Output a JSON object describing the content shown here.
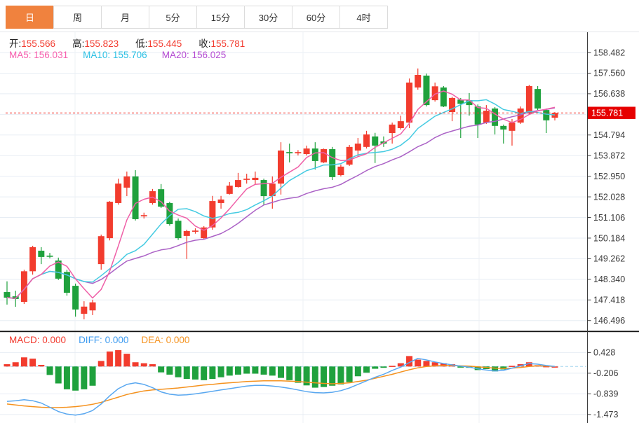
{
  "tabs": {
    "items": [
      {
        "label": "日",
        "active": true
      },
      {
        "label": "周",
        "active": false
      },
      {
        "label": "月",
        "active": false
      },
      {
        "label": "5分",
        "active": false
      },
      {
        "label": "15分",
        "active": false
      },
      {
        "label": "30分",
        "active": false
      },
      {
        "label": "60分",
        "active": false
      },
      {
        "label": "4时",
        "active": false
      }
    ]
  },
  "info": {
    "ohlc": [
      {
        "label": "开:",
        "value": "155.566"
      },
      {
        "label": "高:",
        "value": "155.823"
      },
      {
        "label": "低:",
        "value": "155.445"
      },
      {
        "label": "收:",
        "value": "155.781"
      }
    ],
    "ma": [
      {
        "label": "MA5:",
        "value": "156.031"
      },
      {
        "label": "MA10:",
        "value": "155.706"
      },
      {
        "label": "MA20:",
        "value": "156.025"
      }
    ]
  },
  "macd_header": [
    {
      "label": "MACD:",
      "value": "0.000"
    },
    {
      "label": "DIFF:",
      "value": "0.000"
    },
    {
      "label": "DEA:",
      "value": "0.000"
    }
  ],
  "colors": {
    "tab_active": "#f0823e",
    "up": "#f23c2e",
    "down": "#1fa13d",
    "ma5": "#ef5fa7",
    "ma10": "#45cbe2",
    "ma20": "#ab62c6",
    "diff_line": "#5aa8f0",
    "dea_line": "#f5921e",
    "grid": "#e7edf4",
    "vgrid": "#edf1f6",
    "axis": "#3c3c3c",
    "badge_bg": "#e60000",
    "dotted_line": "#f5352f",
    "zero_dash": "#a5d5ef",
    "tick_text": "#3a3a3a",
    "separator": "#151515"
  },
  "chart_data": {
    "type": "candlestick+macd",
    "title": "",
    "price_axis": {
      "price_top": 158.482,
      "step_val": 0.922,
      "grid_count": 14,
      "visible_ticks": [
        "158.482",
        "157.560",
        "156.638",
        "154.794",
        "153.872",
        "152.950",
        "152.028",
        "151.106",
        "150.184",
        "149.262",
        "148.340",
        "147.418",
        "146.496"
      ],
      "hidden_tick": "155.716"
    },
    "last_price": "155.781",
    "vgrid_x": [
      107,
      432,
      683
    ],
    "candles": [
      [
        147.77,
        148.25,
        147.21,
        147.52
      ],
      [
        147.58,
        147.83,
        147.11,
        147.46
      ],
      [
        147.33,
        148.77,
        147.24,
        148.7
      ],
      [
        148.7,
        149.84,
        148.55,
        149.78
      ],
      [
        149.62,
        149.78,
        149.02,
        149.34
      ],
      [
        149.4,
        149.52,
        149.28,
        149.38
      ],
      [
        149.18,
        149.31,
        148.31,
        148.37
      ],
      [
        148.67,
        148.77,
        147.61,
        147.74
      ],
      [
        148.05,
        148.15,
        146.67,
        146.99
      ],
      [
        146.8,
        147.36,
        146.55,
        147.12
      ],
      [
        146.95,
        147.43,
        146.74,
        147.31
      ],
      [
        149.02,
        150.34,
        148.77,
        150.27
      ],
      [
        150.18,
        151.84,
        150.08,
        151.81
      ],
      [
        151.75,
        152.84,
        151.68,
        152.62
      ],
      [
        152.44,
        153.16,
        152.06,
        152.94
      ],
      [
        152.94,
        153.22,
        150.97,
        151.03
      ],
      [
        151.19,
        151.32,
        151.06,
        151.21
      ],
      [
        151.75,
        152.38,
        151.68,
        152.28
      ],
      [
        152.37,
        152.6,
        151.53,
        151.59
      ],
      [
        151.75,
        151.81,
        150.74,
        150.81
      ],
      [
        150.96,
        151.06,
        150.1,
        150.18
      ],
      [
        150.28,
        150.56,
        149.25,
        150.5
      ],
      [
        150.5,
        150.62,
        150.38,
        150.52
      ],
      [
        150.18,
        150.72,
        150.12,
        150.66
      ],
      [
        150.66,
        152.07,
        150.56,
        151.84
      ],
      [
        151.75,
        152.07,
        151.5,
        151.91
      ],
      [
        152.16,
        152.69,
        152.13,
        152.53
      ],
      [
        152.47,
        153.1,
        152.44,
        152.78
      ],
      [
        152.8,
        153.06,
        152.62,
        152.84
      ],
      [
        152.78,
        153.16,
        152.56,
        152.88
      ],
      [
        152.78,
        152.84,
        151.66,
        152.06
      ],
      [
        152.06,
        152.94,
        151.5,
        152.62
      ],
      [
        152.62,
        154.47,
        152.13,
        154.1
      ],
      [
        154.03,
        154.41,
        153.57,
        154.0
      ],
      [
        154.0,
        154.12,
        153.88,
        154.03
      ],
      [
        153.94,
        154.32,
        153.88,
        154.19
      ],
      [
        154.19,
        154.47,
        153.25,
        153.63
      ],
      [
        153.57,
        154.19,
        153.54,
        154.16
      ],
      [
        154.16,
        154.26,
        152.78,
        152.91
      ],
      [
        153.0,
        153.47,
        152.94,
        153.38
      ],
      [
        153.47,
        154.35,
        153.41,
        154.26
      ],
      [
        154.1,
        154.66,
        153.85,
        154.41
      ],
      [
        154.26,
        154.98,
        154.19,
        154.82
      ],
      [
        154.73,
        154.89,
        153.54,
        154.32
      ],
      [
        154.51,
        154.73,
        154.26,
        154.41
      ],
      [
        154.88,
        155.35,
        154.41,
        155.26
      ],
      [
        155.1,
        155.66,
        155.04,
        155.41
      ],
      [
        155.35,
        157.32,
        155.1,
        157.14
      ],
      [
        156.92,
        157.77,
        156.82,
        157.48
      ],
      [
        157.45,
        157.54,
        156.07,
        156.13
      ],
      [
        156.35,
        157.14,
        156.29,
        156.97
      ],
      [
        156.92,
        156.98,
        156.04,
        156.07
      ],
      [
        155.82,
        156.51,
        155.41,
        156.45
      ],
      [
        156.38,
        156.45,
        154.66,
        156.19
      ],
      [
        156.35,
        156.67,
        155.66,
        156.13
      ],
      [
        156.07,
        156.16,
        154.66,
        155.26
      ],
      [
        155.35,
        156.13,
        155.29,
        155.88
      ],
      [
        155.98,
        156.04,
        154.82,
        155.2
      ],
      [
        155.2,
        155.26,
        154.41,
        155.04
      ],
      [
        154.98,
        155.51,
        154.32,
        155.35
      ],
      [
        155.35,
        156.07,
        155.29,
        155.98
      ],
      [
        155.76,
        157.04,
        155.7,
        156.98
      ],
      [
        156.85,
        156.98,
        155.91,
        155.98
      ],
      [
        155.91,
        155.98,
        154.88,
        155.45
      ],
      [
        155.566,
        155.823,
        155.445,
        155.781
      ]
    ],
    "ma_periods": [
      5,
      10,
      20
    ],
    "macd": {
      "axis_ticks": [
        "0.428",
        "-0.206",
        "-0.839",
        "-1.473"
      ],
      "histogram": [
        0.07,
        0.13,
        0.28,
        0.24,
        0.05,
        -0.26,
        -0.52,
        -0.7,
        -0.74,
        -0.7,
        -0.59,
        0.17,
        0.46,
        0.5,
        0.39,
        0.13,
        0.1,
        0.07,
        -0.18,
        -0.25,
        -0.33,
        -0.38,
        -0.4,
        -0.42,
        -0.38,
        -0.33,
        -0.28,
        -0.25,
        -0.22,
        -0.22,
        -0.25,
        -0.28,
        -0.35,
        -0.42,
        -0.5,
        -0.58,
        -0.65,
        -0.63,
        -0.59,
        -0.55,
        -0.48,
        -0.3,
        -0.19,
        -0.07,
        -0.04,
        0.02,
        0.1,
        0.32,
        0.21,
        0.17,
        0.13,
        0.1,
        0.07,
        -0.02,
        -0.04,
        -0.11,
        -0.08,
        -0.15,
        -0.09,
        0.02,
        0.07,
        0.13,
        0.04,
        0.01,
        0.0
      ],
      "diff": [
        -1.07,
        -1.05,
        -1.02,
        -1.05,
        -1.12,
        -1.25,
        -1.38,
        -1.46,
        -1.49,
        -1.45,
        -1.35,
        -1.15,
        -0.9,
        -0.68,
        -0.55,
        -0.5,
        -0.55,
        -0.65,
        -0.78,
        -0.85,
        -0.88,
        -0.87,
        -0.84,
        -0.8,
        -0.76,
        -0.72,
        -0.68,
        -0.64,
        -0.6,
        -0.58,
        -0.58,
        -0.6,
        -0.63,
        -0.67,
        -0.72,
        -0.77,
        -0.8,
        -0.81,
        -0.79,
        -0.74,
        -0.66,
        -0.55,
        -0.44,
        -0.33,
        -0.24,
        -0.12,
        -0.02,
        0.12,
        0.25,
        0.2,
        0.14,
        0.09,
        0.05,
        0.01,
        -0.02,
        -0.07,
        -0.11,
        -0.14,
        -0.12,
        -0.05,
        0.02,
        0.09,
        0.07,
        0.03,
        0.0
      ],
      "dea": [
        -1.15,
        -1.18,
        -1.21,
        -1.23,
        -1.25,
        -1.26,
        -1.26,
        -1.25,
        -1.23,
        -1.2,
        -1.16,
        -1.1,
        -1.02,
        -0.94,
        -0.86,
        -0.8,
        -0.75,
        -0.72,
        -0.7,
        -0.68,
        -0.66,
        -0.63,
        -0.6,
        -0.57,
        -0.55,
        -0.52,
        -0.5,
        -0.48,
        -0.46,
        -0.45,
        -0.44,
        -0.44,
        -0.44,
        -0.45,
        -0.46,
        -0.48,
        -0.5,
        -0.52,
        -0.53,
        -0.52,
        -0.5,
        -0.46,
        -0.42,
        -0.36,
        -0.3,
        -0.24,
        -0.17,
        -0.1,
        -0.04,
        0.0,
        0.02,
        0.03,
        0.03,
        0.02,
        0.01,
        -0.01,
        -0.03,
        -0.05,
        -0.06,
        -0.05,
        -0.03,
        0.0,
        0.02,
        0.01,
        0.0
      ]
    }
  }
}
